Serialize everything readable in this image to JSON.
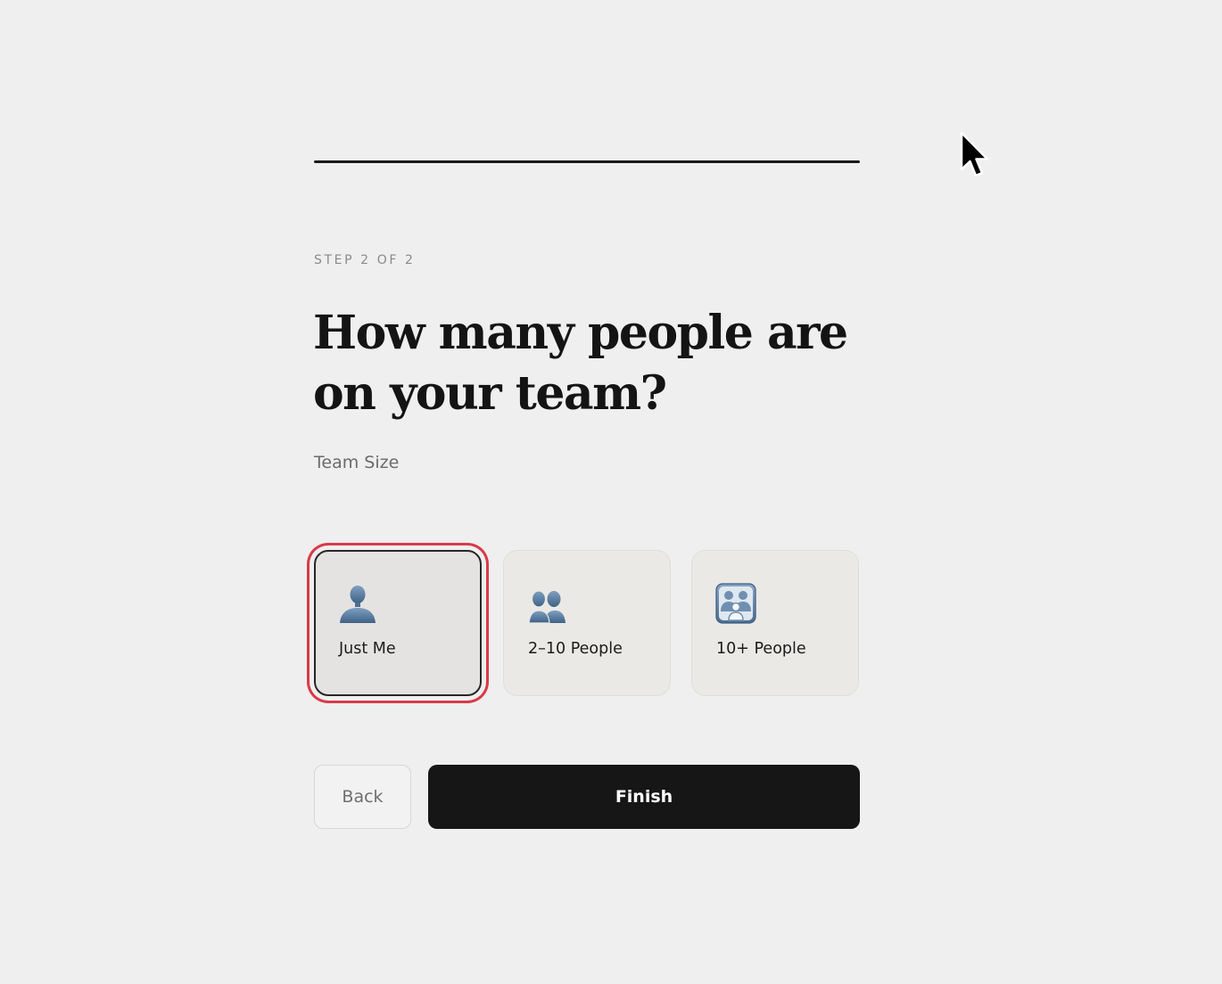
{
  "progress": {
    "fraction": 1.0
  },
  "step_label": "STEP 2 OF 2",
  "heading": {
    "line1": "How many people are",
    "line2": "on your team?"
  },
  "subtitle": "Team Size",
  "options": [
    {
      "label": "Just Me",
      "icon": "single-person-icon",
      "selected": true
    },
    {
      "label": "2–10 People",
      "icon": "two-people-icon",
      "selected": false
    },
    {
      "label": "10+ People",
      "icon": "group-people-icon",
      "selected": false
    }
  ],
  "buttons": {
    "back_label": "Back",
    "finish_label": "Finish"
  },
  "colors": {
    "background": "#efefef",
    "selection_ring": "#d93a48",
    "primary_button": "#161616",
    "icon_blue": "#5b7fa3"
  }
}
